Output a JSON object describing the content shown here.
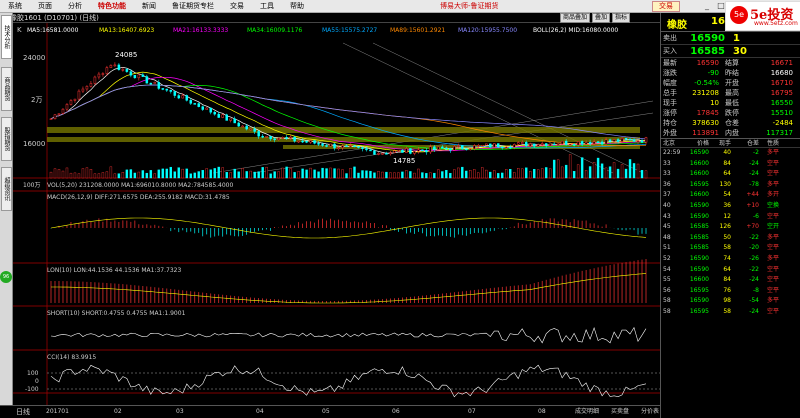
{
  "menu": {
    "items": [
      "系统",
      "页面",
      "分析",
      "特色功能",
      "新闻",
      "鲁证期货专栏",
      "交易",
      "工具",
      "帮助"
    ],
    "active_index": 3,
    "app_title": "博易大师-鲁证期货",
    "trade_button": "交易",
    "win_controls": [
      "_",
      "□",
      "×"
    ]
  },
  "titlebar": {
    "contract": "橡胶1601 (D10701) (日线)",
    "buttons": [
      "商品叠加",
      "叠加",
      "指标"
    ]
  },
  "left_tabs": [
    "技术分析",
    "商品期货",
    "股指期货",
    "超级资讯"
  ],
  "left_dot": "96",
  "main_chart": {
    "indicator_label": "K",
    "ma_legend": [
      {
        "text": "MA5:16581.0000",
        "color": "#ffffff"
      },
      {
        "text": "MA13:16407.6923",
        "color": "#ffff00"
      },
      {
        "text": "MA21:16133.3333",
        "color": "#ff00ff"
      },
      {
        "text": "MA34:16009.1176",
        "color": "#00ff00"
      },
      {
        "text": "MA55:15575.2727",
        "color": "#00aaff"
      },
      {
        "text": "MA89:15601.2921",
        "color": "#ff8800"
      },
      {
        "text": "MA120:15955.7500",
        "color": "#8888ff"
      },
      {
        "text": "BOLL(26,2) MID:16080.0000",
        "color": "#ffffff"
      }
    ],
    "y_ticks": [
      "24000",
      "2万",
      "16000"
    ],
    "high_label": "24085",
    "low_label": "14785"
  },
  "panels": [
    {
      "id": "vol",
      "legend": "VOL(5,20) 231208.0000 MA1:696010.8000 MA2:784585.4000",
      "scale": "100万"
    },
    {
      "id": "macd",
      "legend": "MACD(26,12,9) DIFF:271.6575 DEA:255.9182 MACD:31.4785",
      "scale": ""
    },
    {
      "id": "lon",
      "legend": "LON(10) LON:44.1536 44.1536 MA1:37.7323",
      "scale": ""
    },
    {
      "id": "short",
      "legend": "SHORT(10) SHORT:0.4755 0.4755 MA1:1.9001",
      "scale": ""
    },
    {
      "id": "cci",
      "legend": "CCI(14) 83.9915",
      "scale": ""
    }
  ],
  "cci_ticks": [
    "100",
    "0",
    "-100"
  ],
  "x_axis": {
    "labels": [
      "201701",
      "02",
      "03",
      "04",
      "05",
      "06",
      "07",
      "08"
    ],
    "period": "日线"
  },
  "bottom_tabs": [
    "成交明细",
    "买卖盘",
    "分价表"
  ],
  "quote": {
    "name": "橡胶",
    "code": "1601",
    "logo_text": "5e投资",
    "logo_url": "www.5etz.com",
    "logo_mark": "5e",
    "sell": {
      "label": "卖出",
      "price": "16590",
      "vol": "1"
    },
    "buy": {
      "label": "买入",
      "price": "16585",
      "vol": "30"
    },
    "rows": [
      {
        "l1": "最新",
        "v1": "16590",
        "c1": "red",
        "l2": "结算",
        "v2": "16671",
        "c2": "red"
      },
      {
        "l1": "涨跌",
        "v1": "-90",
        "c1": "grn",
        "l2": "昨结",
        "v2": "16680",
        "c2": "wht"
      },
      {
        "l1": "幅度",
        "v1": "-0.54%",
        "c1": "grn",
        "l2": "开盘",
        "v2": "16710",
        "c2": "red"
      },
      {
        "l1": "总手",
        "v1": "231208",
        "c1": "yel",
        "l2": "最高",
        "v2": "16795",
        "c2": "red"
      },
      {
        "l1": "现手",
        "v1": "10",
        "c1": "yel",
        "l2": "最低",
        "v2": "16550",
        "c2": "grn"
      },
      {
        "l1": "涨停",
        "v1": "17845",
        "c1": "red",
        "l2": "跌停",
        "v2": "15510",
        "c2": "grn"
      },
      {
        "l1": "持仓",
        "v1": "378630",
        "c1": "yel",
        "l2": "仓差",
        "v2": "-2484",
        "c2": "yel"
      },
      {
        "l1": "外盘",
        "v1": "113891",
        "c1": "red",
        "l2": "内盘",
        "v2": "117317",
        "c2": "grn"
      }
    ]
  },
  "ticks": {
    "header": [
      "北京",
      "价格",
      "现手",
      "仓差",
      "性质"
    ],
    "rows": [
      {
        "t": "22:59",
        "p": "16590",
        "v": "40",
        "c": "-2",
        "n": "多平",
        "nc": "red"
      },
      {
        "t": "33",
        "p": "16600",
        "v": "84",
        "c": "-24",
        "n": "空平",
        "nc": "red"
      },
      {
        "t": "33",
        "p": "16600",
        "v": "64",
        "c": "-24",
        "n": "空平",
        "nc": "red"
      },
      {
        "t": "36",
        "p": "16595",
        "v": "130",
        "c": "-78",
        "n": "多平",
        "nc": "red"
      },
      {
        "t": "37",
        "p": "16600",
        "v": "54",
        "c": "+44",
        "n": "多开",
        "nc": "red"
      },
      {
        "t": "40",
        "p": "16590",
        "v": "36",
        "c": "+10",
        "n": "空换",
        "nc": "grn"
      },
      {
        "t": "43",
        "p": "16590",
        "v": "12",
        "c": "-6",
        "n": "空平",
        "nc": "red"
      },
      {
        "t": "45",
        "p": "16585",
        "v": "126",
        "c": "+70",
        "n": "空开",
        "nc": "grn"
      },
      {
        "t": "48",
        "p": "16585",
        "v": "50",
        "c": "-22",
        "n": "多平",
        "nc": "red"
      },
      {
        "t": "51",
        "p": "16585",
        "v": "58",
        "c": "-20",
        "n": "空平",
        "nc": "red"
      },
      {
        "t": "52",
        "p": "16590",
        "v": "74",
        "c": "-26",
        "n": "多平",
        "nc": "red"
      },
      {
        "t": "54",
        "p": "16590",
        "v": "64",
        "c": "-22",
        "n": "空平",
        "nc": "red"
      },
      {
        "t": "55",
        "p": "16600",
        "v": "84",
        "c": "-24",
        "n": "空平",
        "nc": "red"
      },
      {
        "t": "56",
        "p": "16595",
        "v": "76",
        "c": "-8",
        "n": "空平",
        "nc": "red"
      },
      {
        "t": "58",
        "p": "16590",
        "v": "98",
        "c": "-54",
        "n": "多平",
        "nc": "red"
      },
      {
        "t": "58",
        "p": "16595",
        "v": "58",
        "c": "-24",
        "n": "空平",
        "nc": "red"
      }
    ]
  }
}
